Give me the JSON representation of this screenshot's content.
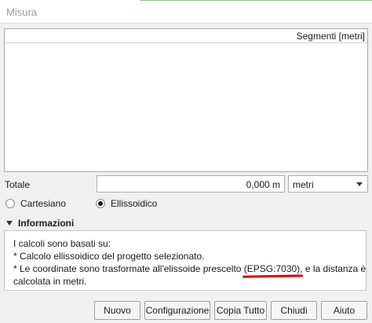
{
  "window": {
    "title": "Misura"
  },
  "table": {
    "column_header": "Segmenti [metri]",
    "rows": []
  },
  "total": {
    "label": "Totale",
    "value": "0,000 m",
    "unit": "metri"
  },
  "mode": {
    "options": [
      "Cartesiano",
      "Ellissoidico"
    ],
    "selected": "Ellissoidico"
  },
  "info": {
    "title": "Informazioni",
    "line1": "I calcoli sono basati su:",
    "line2": "* Calcolo ellissoidico del progetto selezionato.",
    "line3_prefix": "* Le coordinate sono trasformate all'elissoide prescelto ",
    "epsg": "(EPSG:7030)",
    "line3_suffix": ", e la distanza è",
    "line4": "calcolata in metri."
  },
  "buttons": {
    "new": "Nuovo",
    "config": "Configurazione",
    "copy_all": "Copia Tutto",
    "close": "Chiudi",
    "help": "Aiuto"
  },
  "colors": {
    "annotation_underline": "#e00000"
  }
}
